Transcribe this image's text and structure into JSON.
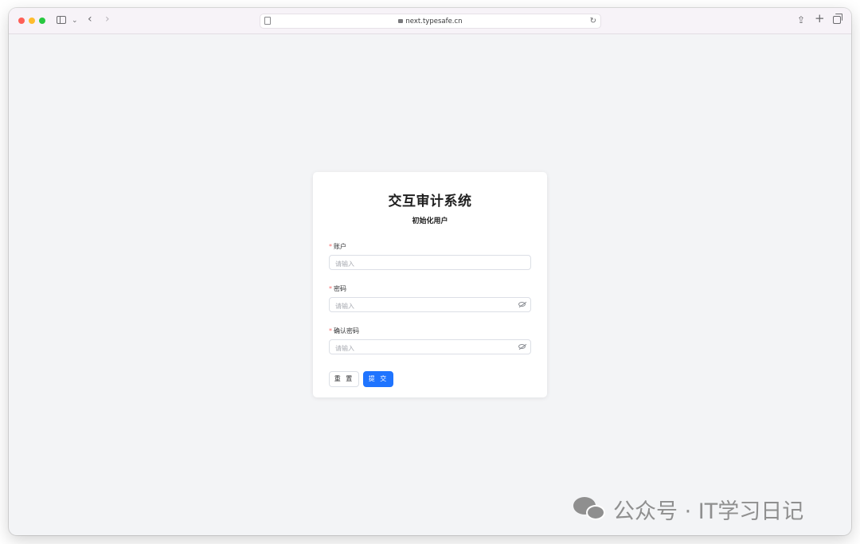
{
  "browser": {
    "url": "next.typesafe.cn"
  },
  "card": {
    "title": "交互审计系统",
    "subtitle": "初始化用户"
  },
  "form": {
    "account": {
      "label": "账户",
      "placeholder": "请输入",
      "required_mark": "*"
    },
    "password": {
      "label": "密码",
      "placeholder": "请输入",
      "required_mark": "*"
    },
    "confirm_password": {
      "label": "确认密码",
      "placeholder": "请输入",
      "required_mark": "*"
    },
    "reset_label": "重 置",
    "submit_label": "提 交"
  },
  "watermark": {
    "text": "公众号 · IT学习日记"
  },
  "colors": {
    "primary": "#1f74ff",
    "required": "#f56c6c",
    "background": "#f3f4f6"
  }
}
